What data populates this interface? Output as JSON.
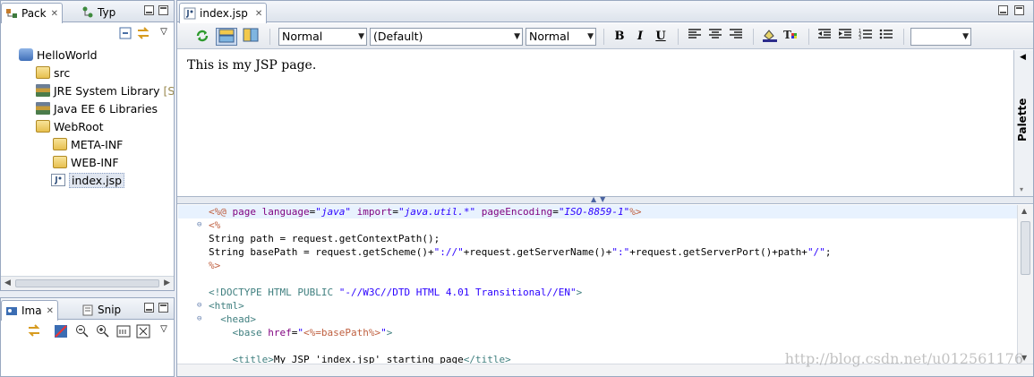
{
  "package_explorer": {
    "tabs": [
      {
        "label": "Pack",
        "icon": "package-explorer-icon",
        "active": true
      },
      {
        "label": "Typ",
        "icon": "type-hierarchy-icon",
        "active": false
      }
    ],
    "tree": [
      {
        "label": "HelloWorld",
        "icon": "project-icon",
        "depth": 0
      },
      {
        "label": "src",
        "icon": "source-folder-icon",
        "depth": 1
      },
      {
        "label": "JRE System Library",
        "suffix": "[Su",
        "icon": "library-icon",
        "depth": 1
      },
      {
        "label": "Java EE 6 Libraries",
        "icon": "library-icon",
        "depth": 1
      },
      {
        "label": "WebRoot",
        "icon": "folder-icon",
        "depth": 1
      },
      {
        "label": "META-INF",
        "icon": "folder-icon",
        "depth": 2
      },
      {
        "label": "WEB-INF",
        "icon": "folder-icon",
        "depth": 2
      },
      {
        "label": "index.jsp",
        "icon": "jsp-file-icon",
        "depth": 2,
        "selected": true
      }
    ]
  },
  "image_view": {
    "tabs": [
      {
        "label": "Ima",
        "icon": "image-view-icon",
        "active": true
      },
      {
        "label": "Snip",
        "icon": "snippets-icon",
        "active": false
      }
    ]
  },
  "editor": {
    "tab_label": "index.jsp",
    "toolbar": {
      "paragraph_style": "Normal",
      "font": "(Default)",
      "font_size": "Normal",
      "bold": "B",
      "italic": "I",
      "underline": "U",
      "extra_combo": ""
    },
    "design_text": "This is my JSP page.",
    "palette_label": "Palette",
    "source_lines": [
      [
        [
          "dir",
          "<%@ "
        ],
        [
          "att",
          "page "
        ],
        [
          "att",
          "language"
        ],
        [
          "txt",
          "="
        ],
        [
          "val",
          "\"java\""
        ],
        [
          "txt",
          " "
        ],
        [
          "att",
          "import"
        ],
        [
          "txt",
          "="
        ],
        [
          "val",
          "\"java.util.*\""
        ],
        [
          "txt",
          " "
        ],
        [
          "att",
          "pageEncoding"
        ],
        [
          "txt",
          "="
        ],
        [
          "val",
          "\"ISO-8859-1\""
        ],
        [
          "dir",
          "%>"
        ]
      ],
      [
        [
          "dir",
          "<%"
        ]
      ],
      [
        [
          "txt",
          "String path = request.getContextPath();"
        ]
      ],
      [
        [
          "txt",
          "String basePath = request.getScheme()+"
        ],
        [
          "str",
          "\"://\""
        ],
        [
          "txt",
          "+request.getServerName()+"
        ],
        [
          "str",
          "\":\""
        ],
        [
          "txt",
          "+request.getServerPort()+path+"
        ],
        [
          "str",
          "\"/\""
        ],
        [
          "txt",
          ";"
        ]
      ],
      [
        [
          "dir",
          "%>"
        ]
      ],
      [
        [
          "txt",
          ""
        ]
      ],
      [
        [
          "tag",
          "<!DOCTYPE HTML PUBLIC "
        ],
        [
          "str",
          "\"-//W3C//DTD HTML 4.01 Transitional//EN\""
        ],
        [
          "tag",
          ">"
        ]
      ],
      [
        [
          "tag",
          "<html>"
        ]
      ],
      [
        [
          "tag",
          "  <head>"
        ]
      ],
      [
        [
          "tag",
          "    <base "
        ],
        [
          "att",
          "href"
        ],
        [
          "txt",
          "="
        ],
        [
          "str",
          "\""
        ],
        [
          "dir",
          "<%=basePath%>"
        ],
        [
          "str",
          "\""
        ],
        [
          "tag",
          ">"
        ]
      ],
      [
        [
          "txt",
          ""
        ]
      ],
      [
        [
          "tag",
          "    <title>"
        ],
        [
          "txt",
          "My JSP 'index.jsp' starting page"
        ],
        [
          "tag",
          "</title>"
        ]
      ]
    ]
  },
  "watermark": "http://blog.csdn.net/u012561176",
  "colors": {
    "accent": "#5d7ea9",
    "directive": "#bf5f3f",
    "attribute": "#7f007f",
    "string": "#2a00ff",
    "tag": "#3f7f7f"
  }
}
